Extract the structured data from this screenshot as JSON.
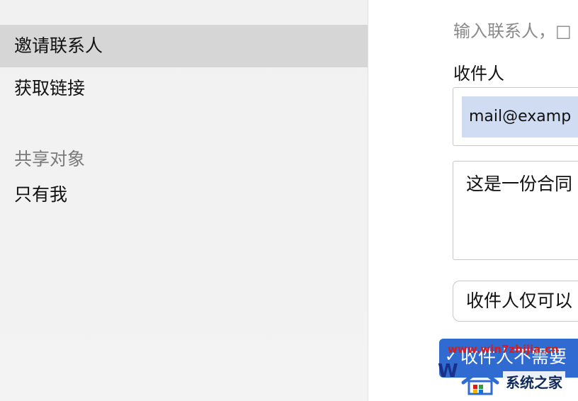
{
  "sidebar": {
    "items": [
      {
        "label": "邀请联系人",
        "selected": true
      },
      {
        "label": "获取链接",
        "selected": false
      }
    ],
    "share_section": {
      "header": "共享对象",
      "value": "只有我"
    }
  },
  "main": {
    "hint": "输入联系人，□",
    "recipient_label": "收件人",
    "recipient_token": "mail@examp",
    "message_text": "这是一份合同",
    "permission_select": "收件人仅可以",
    "login_requirement": "收件人不需要"
  },
  "watermark": {
    "url": "www.win7zhijia.cn",
    "brand": "系统之家"
  },
  "colors": {
    "sidebar_bg": "#f2f2f2",
    "sidebar_selected_bg": "#d6d6d6",
    "token_bg": "#cfdcf2",
    "accent_blue": "#2f6bd0",
    "watermark_red": "#e01818"
  }
}
